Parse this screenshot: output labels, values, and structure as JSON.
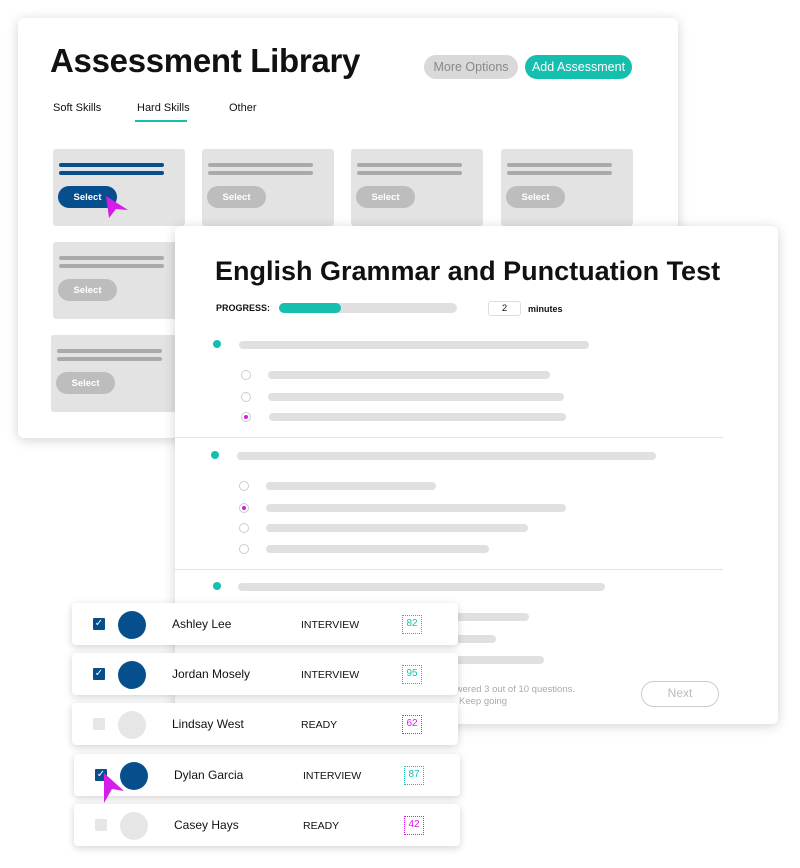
{
  "library": {
    "title": "Assessment Library",
    "more_options": "More Options",
    "add_assessment": "Add Assessment",
    "tabs": [
      {
        "label": "Soft Skills",
        "active": false
      },
      {
        "label": "Hard Skills",
        "active": true
      },
      {
        "label": "Other",
        "active": false
      }
    ],
    "tile_button": "Select"
  },
  "test": {
    "title": "English Grammar and Punctuation Test",
    "progress_label": "PROGRESS:",
    "progress_percent": 35,
    "minutes_value": "2",
    "minutes_label": "minutes",
    "footer_text": "You've answered 3 out of 10 questions.",
    "footer_sub": "Keep going",
    "next": "Next"
  },
  "candidates": [
    {
      "name": "Ashley Lee",
      "status": "INTERVIEW",
      "score": "82",
      "checked": true
    },
    {
      "name": "Jordan Mosely",
      "status": "INTERVIEW",
      "score": "95",
      "checked": true
    },
    {
      "name": "Lindsay West",
      "status": "READY",
      "score": "62",
      "checked": false
    },
    {
      "name": "Dylan Garcia",
      "status": "INTERVIEW",
      "score": "87",
      "checked": true
    },
    {
      "name": "Casey Hays",
      "status": "READY",
      "score": "42",
      "checked": false
    }
  ],
  "colors": {
    "teal": "#14bfae",
    "navy": "#064f8c",
    "magenta": "#d51ce8"
  }
}
